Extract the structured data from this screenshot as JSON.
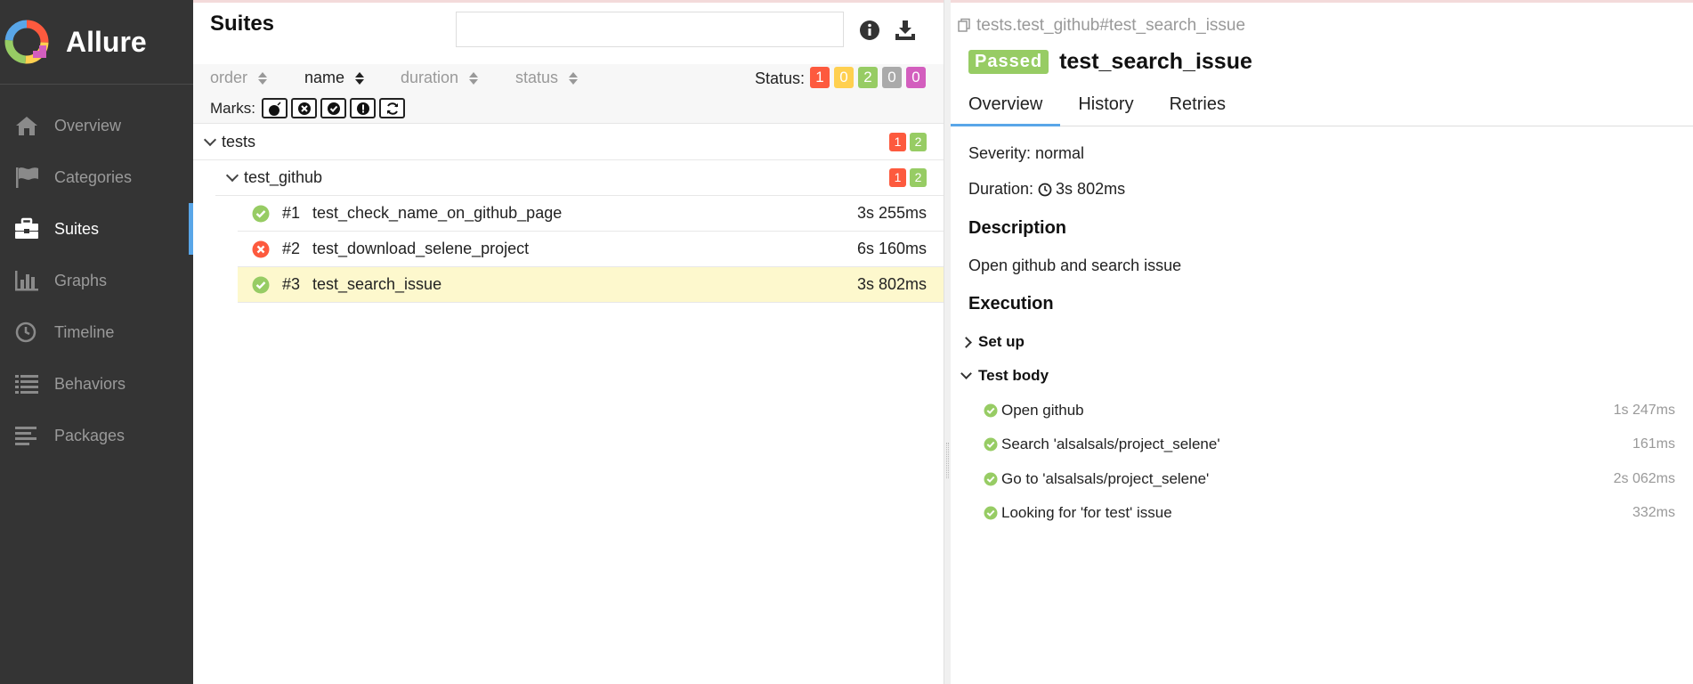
{
  "app": {
    "name": "Allure"
  },
  "sidebar": {
    "items": [
      {
        "label": "Overview",
        "icon": "home-icon",
        "active": false
      },
      {
        "label": "Categories",
        "icon": "flag-icon",
        "active": false
      },
      {
        "label": "Suites",
        "icon": "briefcase-icon",
        "active": true
      },
      {
        "label": "Graphs",
        "icon": "bar-chart-icon",
        "active": false
      },
      {
        "label": "Timeline",
        "icon": "clock-icon",
        "active": false
      },
      {
        "label": "Behaviors",
        "icon": "list-icon",
        "active": false
      },
      {
        "label": "Packages",
        "icon": "align-left-icon",
        "active": false
      }
    ]
  },
  "suites": {
    "title": "Suites",
    "search_value": "",
    "sort": [
      {
        "label": "order",
        "active": false
      },
      {
        "label": "name",
        "active": true
      },
      {
        "label": "duration",
        "active": false
      },
      {
        "label": "status",
        "active": false
      }
    ],
    "status_label": "Status:",
    "status_counts": [
      {
        "value": "1",
        "color": "#fd5a3e"
      },
      {
        "value": "0",
        "color": "#ffd050"
      },
      {
        "value": "2",
        "color": "#97cc64"
      },
      {
        "value": "0",
        "color": "#aaaaaa"
      },
      {
        "value": "0",
        "color": "#d35ebe"
      }
    ],
    "marks_label": "Marks:",
    "marks": [
      "flaky-icon",
      "new-failed-icon",
      "new-passed-icon",
      "new-broken-icon",
      "retries-icon"
    ],
    "tree": {
      "group": {
        "label": "tests",
        "failed": "1",
        "passed": "2"
      },
      "subgroup": {
        "label": "test_github",
        "failed": "1",
        "passed": "2"
      },
      "tests": [
        {
          "num": "#1",
          "name": "test_check_name_on_github_page",
          "duration": "3s 255ms",
          "status": "passed"
        },
        {
          "num": "#2",
          "name": "test_download_selene_project",
          "duration": "6s 160ms",
          "status": "failed"
        },
        {
          "num": "#3",
          "name": "test_search_issue",
          "duration": "3s 802ms",
          "status": "passed"
        }
      ]
    }
  },
  "detail": {
    "breadcrumb": "tests.test_github#test_search_issue",
    "status": "Passed",
    "title": "test_search_issue",
    "tabs": [
      "Overview",
      "History",
      "Retries"
    ],
    "severity": "Severity: normal",
    "duration_label": "Duration:",
    "duration": "3s 802ms",
    "description_title": "Description",
    "description": "Open github and search issue",
    "execution_title": "Execution",
    "setup_label": "Set up",
    "body_label": "Test body",
    "steps": [
      {
        "name": "Open github",
        "duration": "1s 247ms"
      },
      {
        "name": "Search 'alsalsals/project_selene'",
        "duration": "161ms"
      },
      {
        "name": "Go to 'alsalsals/project_selene'",
        "duration": "2s 062ms"
      },
      {
        "name": "Looking for 'for test' issue",
        "duration": "332ms"
      }
    ]
  },
  "colors": {
    "passed": "#97cc64",
    "failed": "#fd5a3e",
    "accent": "#59a6e8",
    "sidebar": "#343434",
    "selected_row": "#fdf8cd"
  }
}
